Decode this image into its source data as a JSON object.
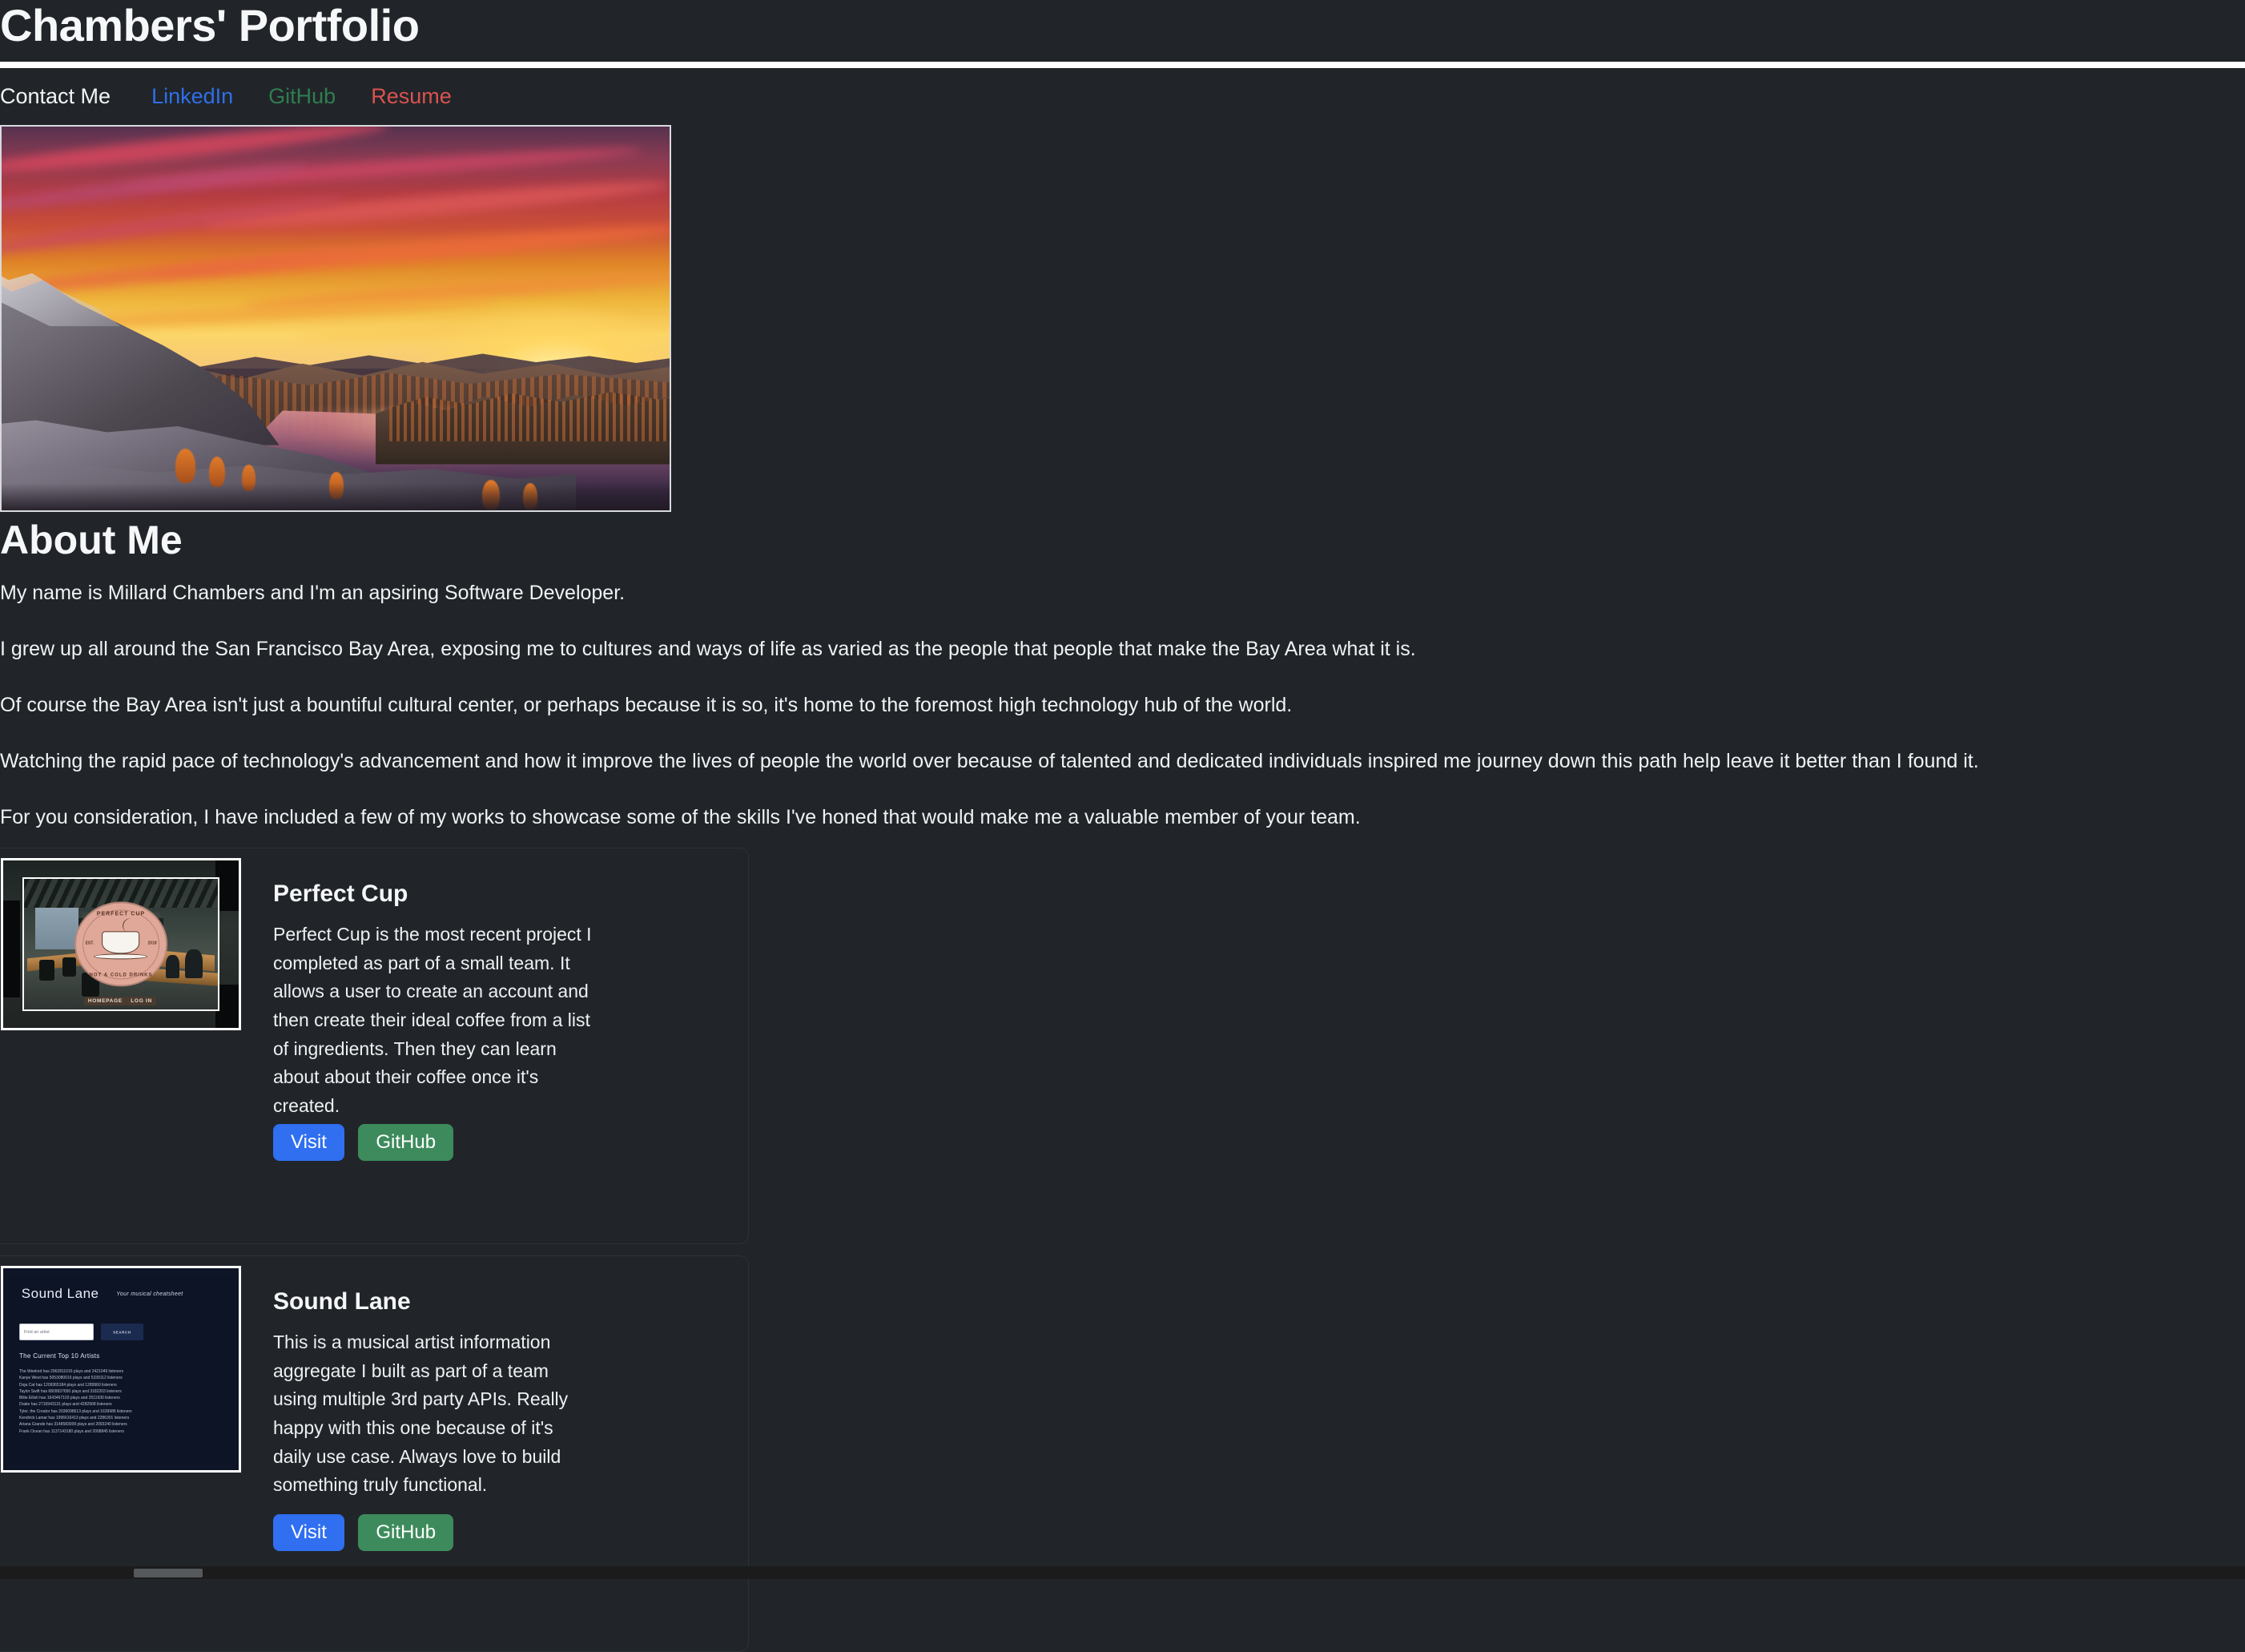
{
  "header": {
    "title": "Chambers' Portfolio"
  },
  "nav": {
    "items": [
      {
        "label": "Contact Me",
        "color": "#f2f4f5",
        "name": "contact-me"
      },
      {
        "label": "LinkedIn",
        "color": "#2f6fe8",
        "name": "linkedin"
      },
      {
        "label": "GitHub",
        "color": "#2f7d4f",
        "name": "github"
      },
      {
        "label": "Resume",
        "color": "#d9534f",
        "name": "resume"
      }
    ]
  },
  "hero": {
    "alt": "alpine-sunset-lake-photo"
  },
  "about": {
    "heading": "About Me",
    "paragraphs": [
      "My name is Millard Chambers and I'm an apsiring Software Developer.",
      "I grew up all around the San Francisco Bay Area, exposing me to cultures and ways of life as varied as the people that people that make the Bay Area what it is.",
      "Of course the Bay Area isn't just a bountiful cultural center, or perhaps because it is so, it's home to the foremost high technology hub of the world.",
      "Watching the rapid pace of technology's advancement and how it improve the lives of people the world over because of talented and dedicated individuals inspired me journey down this path help leave it better than I found it.",
      "For you consideration, I have included a few of my works to showcase some of the skills I've honed that would make me a valuable member of your team."
    ]
  },
  "projects": [
    {
      "title": "Perfect Cup",
      "text": "Perfect Cup is the most recent project I completed as part of a small team. It allows a user to create an account and then create their ideal coffee from a list of ingredients. Then they can learn about about their coffee once it's created.",
      "visit_label": "Visit",
      "github_label": "GitHub",
      "thumbnail": {
        "logo_top": "PERFECT CUP",
        "logo_bottom": "HOT & COLD DRINKS",
        "est_left": "EST.",
        "est_right": "2018",
        "nav_home": "HOMEPAGE",
        "nav_login": "LOG IN"
      }
    },
    {
      "title": "Sound Lane",
      "text": "This is a musical artist information aggregate I built as part of a team using multiple 3rd party APIs. Really happy with this one because of it's daily use case. Always love to build something truly functional.",
      "visit_label": "Visit",
      "github_label": "GitHub",
      "thumbnail": {
        "brand": "Sound Lane",
        "tagline": "Your musical cheatsheet",
        "search_placeholder": "Find an artist",
        "search_button": "SEARCH",
        "list_heading": "The Current Top 10 Artists",
        "rows": [
          "The Weeknd has 2962811016 plays and 2421049 listeners",
          "Kanye West has 5053080016 plays and 5339112 listeners",
          "Doja Cat has 1209365184 plays and 1289960 listeners",
          "Taylor Swift has 6809937650 plays and 3182203 listeners",
          "Billie Eilish has 1643467103 plays and 2511930 listeners",
          "Drake has 2716943131 plays and 4282908 listeners",
          "Tyler, the Creator has 2036098613 plays and 1639986 listeners",
          "Kendrick Lamar has 1996616413 plays and 2286301 listeners",
          "Ariana Grande has 3148583009 plays and 2093240 listeners",
          "Frank Ocean has 1137143180 plays and 2008845 listeners"
        ]
      }
    }
  ],
  "colors": {
    "background": "#212529",
    "text": "#f0f2f3",
    "accent_blue": "#2f6ff0",
    "accent_green": "#3d8b5c",
    "accent_red": "#d9534f",
    "rule": "#ffffff"
  },
  "scrollbar": {
    "orientation": "horizontal"
  }
}
